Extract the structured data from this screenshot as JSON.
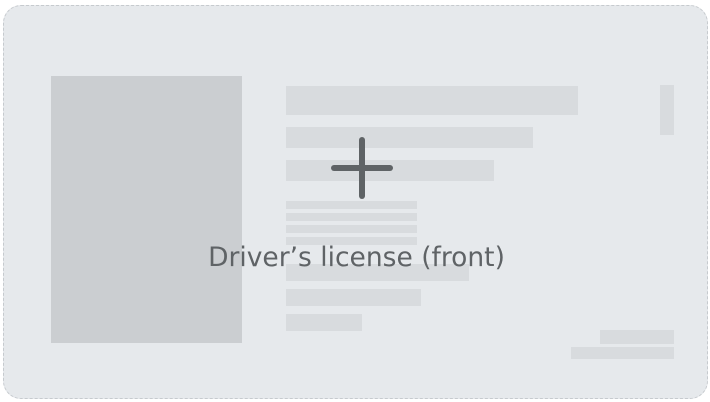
{
  "upload": {
    "label": "Driver’s license (front)",
    "icon": "plus-icon",
    "colors": {
      "card_background": "#e6e9ec",
      "card_border": "#c6cace",
      "placeholder_block": "#d8dbde",
      "photo_block": "#cbced1",
      "icon": "#5f6366",
      "label": "#5f6366"
    }
  }
}
